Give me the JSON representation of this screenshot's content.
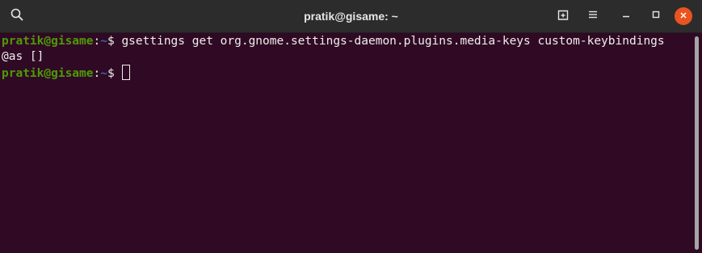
{
  "window": {
    "title": "pratik@gisame: ~"
  },
  "icons": {
    "search": "search-icon",
    "new_tab": "new-tab-icon",
    "menu": "hamburger-menu-icon",
    "minimize": "minimize-icon",
    "maximize": "maximize-icon",
    "close": "close-icon"
  },
  "colors": {
    "background": "#300a24",
    "titlebar": "#2c2c2c",
    "prompt_user": "#4e9a06",
    "prompt_path": "#3465a4",
    "text": "#eeeeec",
    "close_button": "#e95420"
  },
  "terminal": {
    "lines": [
      {
        "user_host": "pratik@gisame",
        "colon": ":",
        "path": "~",
        "dollar": "$ ",
        "command": "gsettings get org.gnome.settings-daemon.plugins.media-keys custom-keybindings"
      },
      {
        "output": "@as []"
      },
      {
        "user_host": "pratik@gisame",
        "colon": ":",
        "path": "~",
        "dollar": "$ "
      }
    ]
  }
}
